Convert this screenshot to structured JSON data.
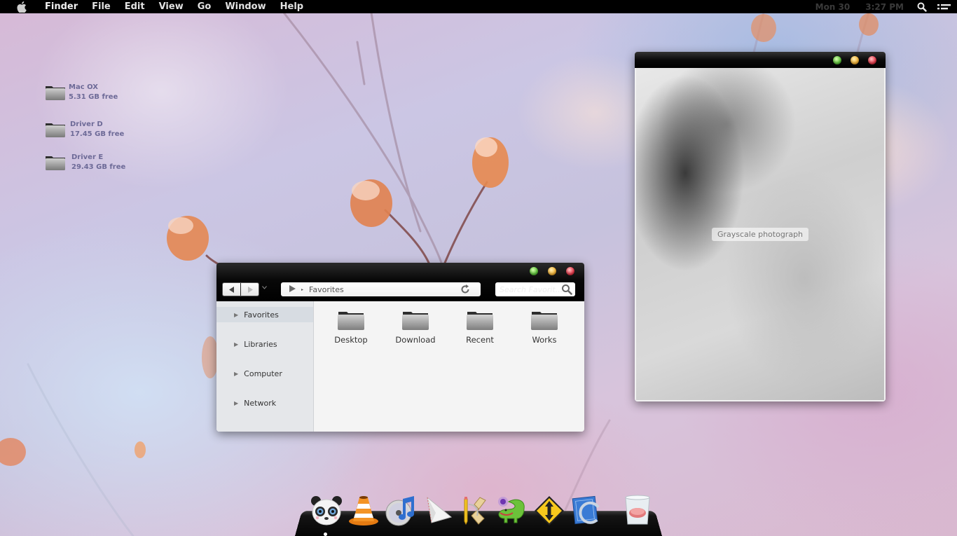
{
  "menubar": {
    "apple_icon": "apple-logo-icon",
    "app_name": "Finder",
    "menus": [
      "File",
      "Edit",
      "View",
      "Go",
      "Window",
      "Help"
    ],
    "clock": {
      "day": "Mon 30",
      "time": "3:27 PM"
    },
    "right_icons": [
      "spotlight-search-icon",
      "notification-list-icon"
    ]
  },
  "desktop": {
    "drives": [
      {
        "name": "Mac OX",
        "free": "5.31 GB free"
      },
      {
        "name": "Driver D",
        "free": "17.45 GB free"
      },
      {
        "name": "Driver E",
        "free": "29.43 GB free"
      }
    ]
  },
  "finder": {
    "nav": {
      "back": "back-arrow-icon",
      "forward": "forward-arrow-icon",
      "dropdown": "chevron-down-icon"
    },
    "address": {
      "root_icon": "play-triangle-icon",
      "separator": "▸",
      "crumb": "Favorites",
      "refresh_icon": "refresh-icon"
    },
    "search": {
      "placeholder": "Search Favorit...",
      "value": ""
    },
    "sidebar": [
      {
        "label": "Favorites",
        "selected": true
      },
      {
        "label": "Libraries",
        "selected": false
      },
      {
        "label": "Computer",
        "selected": false
      },
      {
        "label": "Network",
        "selected": false
      }
    ],
    "items": [
      {
        "label": "Desktop"
      },
      {
        "label": "Download"
      },
      {
        "label": "Recent"
      },
      {
        "label": "Works"
      }
    ]
  },
  "viewer": {
    "photo_label": "Grayscale photograph"
  },
  "dock": {
    "items": [
      {
        "name": "panda-app",
        "icon": "panda-icon"
      },
      {
        "name": "vlc",
        "icon": "traffic-cone-icon"
      },
      {
        "name": "itunes",
        "icon": "music-cd-icon"
      },
      {
        "name": "mail",
        "icon": "paper-plane-icon"
      },
      {
        "name": "sketch-tools",
        "icon": "pencil-ruler-icon"
      },
      {
        "name": "crocodile-app",
        "icon": "crocodile-icon"
      },
      {
        "name": "transfer-app",
        "icon": "up-down-sign-icon"
      },
      {
        "name": "preview-app",
        "icon": "blueprint-icon"
      },
      {
        "name": "trash",
        "icon": "trash-glass-icon"
      }
    ]
  },
  "colors": {
    "traffic_green": "#5cc23a",
    "traffic_yellow": "#f5b436",
    "traffic_red": "#e6394a",
    "drive_label": "#6d6a97",
    "sidebar_bg": "#e5e7ea",
    "content_bg": "#f4f4f4"
  }
}
